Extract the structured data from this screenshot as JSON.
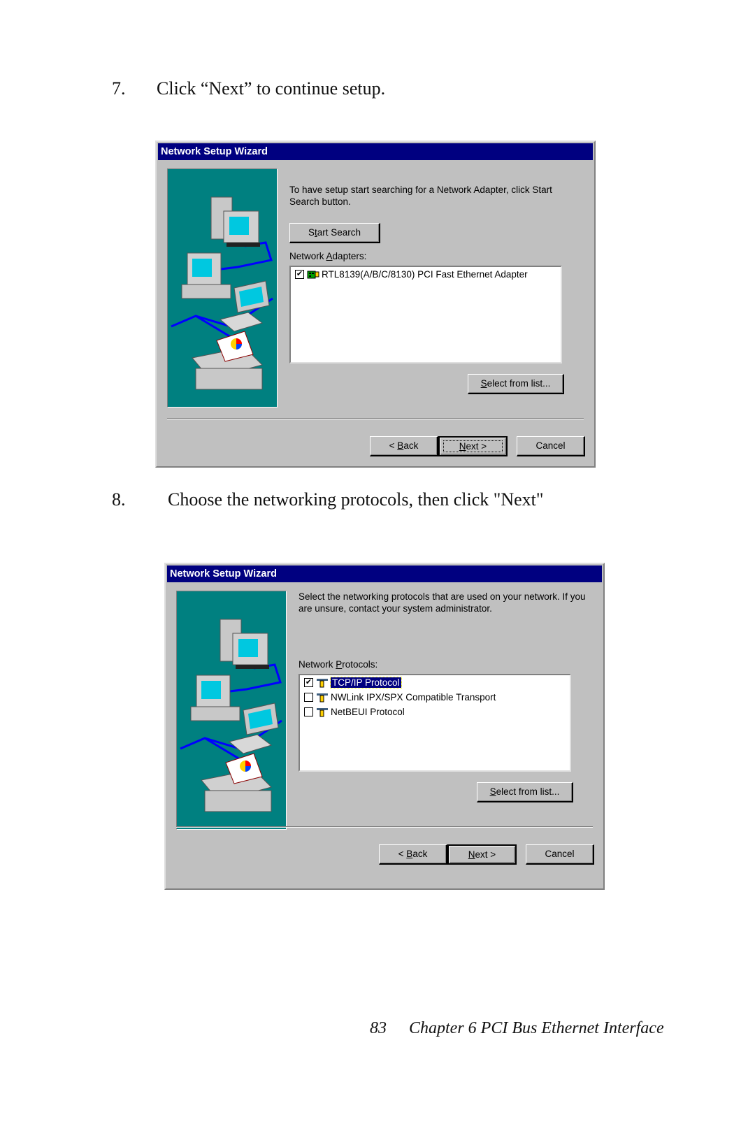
{
  "steps": [
    {
      "number": "7.",
      "text": "Click “Next” to continue setup."
    },
    {
      "number": "8.",
      "text": "Choose the networking protocols, then click \"Next\""
    }
  ],
  "dialog1": {
    "title": "Network Setup Wizard",
    "description": "To have setup start searching for a Network Adapter, click Start Search button.",
    "start_search": {
      "pre": "S",
      "key": "t",
      "post": "art Search"
    },
    "list_label": {
      "pre": "Network ",
      "key": "A",
      "post": "dapters:"
    },
    "items": [
      {
        "checked": true,
        "icon": "network-card-icon",
        "label": "RTL8139(A/B/C/8130) PCI Fast Ethernet Adapter"
      }
    ],
    "select_from_list": {
      "pre": "",
      "key": "S",
      "post": "elect from list..."
    },
    "back": {
      "pre": "< ",
      "key": "B",
      "post": "ack"
    },
    "next": {
      "pre": "",
      "key": "N",
      "post": "ext >"
    },
    "cancel": "Cancel"
  },
  "dialog2": {
    "title": "Network Setup Wizard",
    "description": "Select the networking protocols that are used on your network. If you are unsure, contact your system administrator.",
    "list_label": {
      "pre": "Network ",
      "key": "P",
      "post": "rotocols:"
    },
    "items": [
      {
        "checked": true,
        "selected": true,
        "icon": "protocol-icon",
        "label": "TCP/IP Protocol"
      },
      {
        "checked": false,
        "selected": false,
        "icon": "protocol-icon",
        "label": "NWLink IPX/SPX Compatible Transport"
      },
      {
        "checked": false,
        "selected": false,
        "icon": "protocol-icon",
        "label": "NetBEUI Protocol"
      }
    ],
    "select_from_list": {
      "pre": "",
      "key": "S",
      "post": "elect from list..."
    },
    "back": {
      "pre": "< ",
      "key": "B",
      "post": "ack"
    },
    "next": {
      "pre": "",
      "key": "N",
      "post": "ext >"
    },
    "cancel": "Cancel"
  },
  "footer": {
    "page": "83",
    "chapter": "Chapter 6  PCI Bus Ethernet Interface"
  },
  "colors": {
    "titlebar": "#000080",
    "dialog_bg": "#c0c0c0",
    "panel_bg": "#008080"
  }
}
